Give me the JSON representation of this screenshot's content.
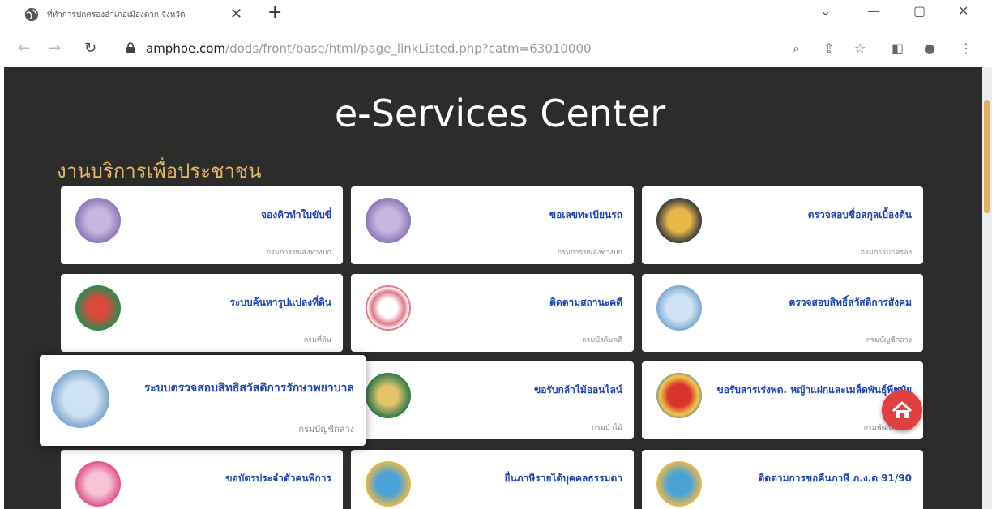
{
  "browser": {
    "tab_title": "ที่ทำการปกครองอำเภอเมืองตาก จังหวัดตาก",
    "url_host": "amphoe.com",
    "url_path": "/dods/front/base/html/page_linkListed.php?catm=63010000"
  },
  "page": {
    "hero_title": "e-Services Center",
    "section_title": "งานบริการเพื่อประชาชน"
  },
  "cards": [
    {
      "name": "จองคิวทำใบขับขี่",
      "dept": "กรมการขนส่งทางบก"
    },
    {
      "name": "ขอเลขทะเบียนรถ",
      "dept": "กรมการขนส่งทางบก"
    },
    {
      "name": "ตรวจสอบชื่อสกุลเบื้องต้น",
      "dept": "กรมการปกครอง"
    },
    {
      "name": "ระบบค้นหารูปแปลงที่ดิน",
      "dept": "กรมที่ดิน"
    },
    {
      "name": "ติดตามสถานะคดี",
      "dept": "กรมบังคับคดี"
    },
    {
      "name": "ตรวจสอบสิทธิ์สวัสดิการสังคม",
      "dept": "กรมบัญชีกลาง"
    },
    {
      "name": "ระบบตรวจสอบสิทธิสวัสดิการรักษาพยาบาล",
      "dept": "กรมบัญชีกลาง"
    },
    {
      "name": "ขอรับกล้าไม้ออนไลน์",
      "dept": "กรมป่าไม้"
    },
    {
      "name": "ขอรับสารเร่งพด. หญ้าแฝกและเมล็ดพันธุ์พืชปุ๋ย",
      "dept": "กรมพัฒนาที่ดิน"
    },
    {
      "name": "ขอบัตรประจำตัวคนพิการ",
      "dept": ""
    },
    {
      "name": "ยื่นภาษีรายได้บุคคลธรรมดา",
      "dept": ""
    },
    {
      "name": "ติดตามการขอคืนภาษี ภ.ง.ด 91/90",
      "dept": ""
    }
  ],
  "icons": {
    "tab": "globe-icon",
    "home": "home-icon"
  },
  "colors": {
    "page_bg": "#2c2c2a",
    "section_title": "#e3b769",
    "card_title": "#1d44b5",
    "home_button": "#e04040"
  }
}
